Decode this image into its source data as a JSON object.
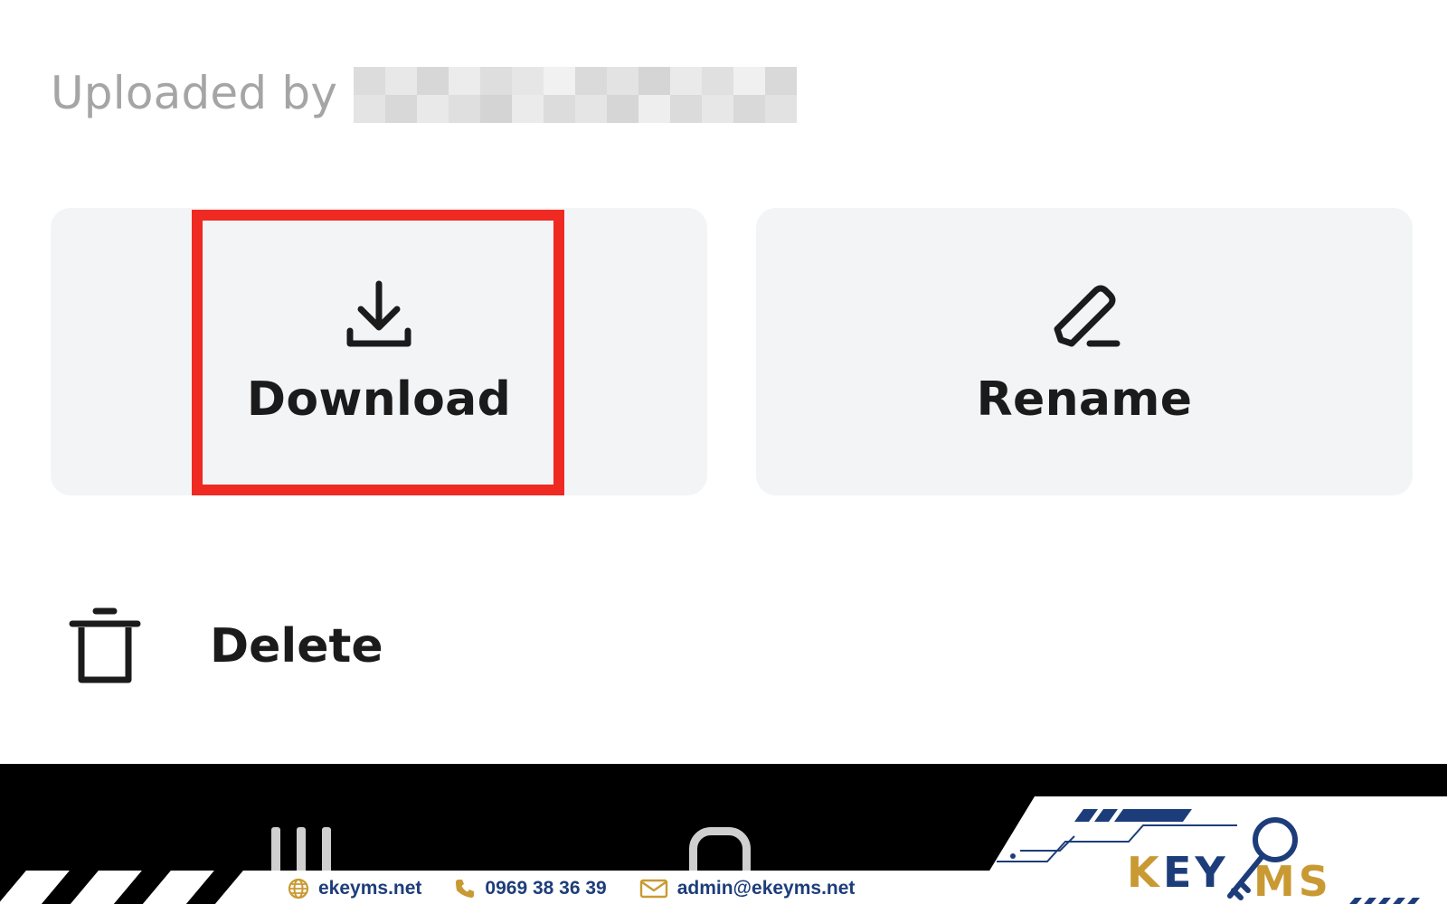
{
  "sheet": {
    "uploaded_by_label": "Uploaded by",
    "actions": {
      "download_label": "Download",
      "rename_label": "Rename",
      "delete_label": "Delete"
    }
  },
  "icons": {
    "download": "download-icon",
    "rename": "pencil-icon",
    "delete": "trash-icon",
    "globe": "globe-icon",
    "phone": "phone-icon",
    "mail": "mail-icon"
  },
  "colors": {
    "highlight": "#ee2a23",
    "card_bg": "#f3f4f5",
    "brand_blue": "#1d3d7a",
    "brand_gold": "#c99a33"
  },
  "footer": {
    "website": "ekeyms.net",
    "phone": "0969 38 36 39",
    "email": "admin@ekeyms.net",
    "logo_text": "KEYMS"
  }
}
